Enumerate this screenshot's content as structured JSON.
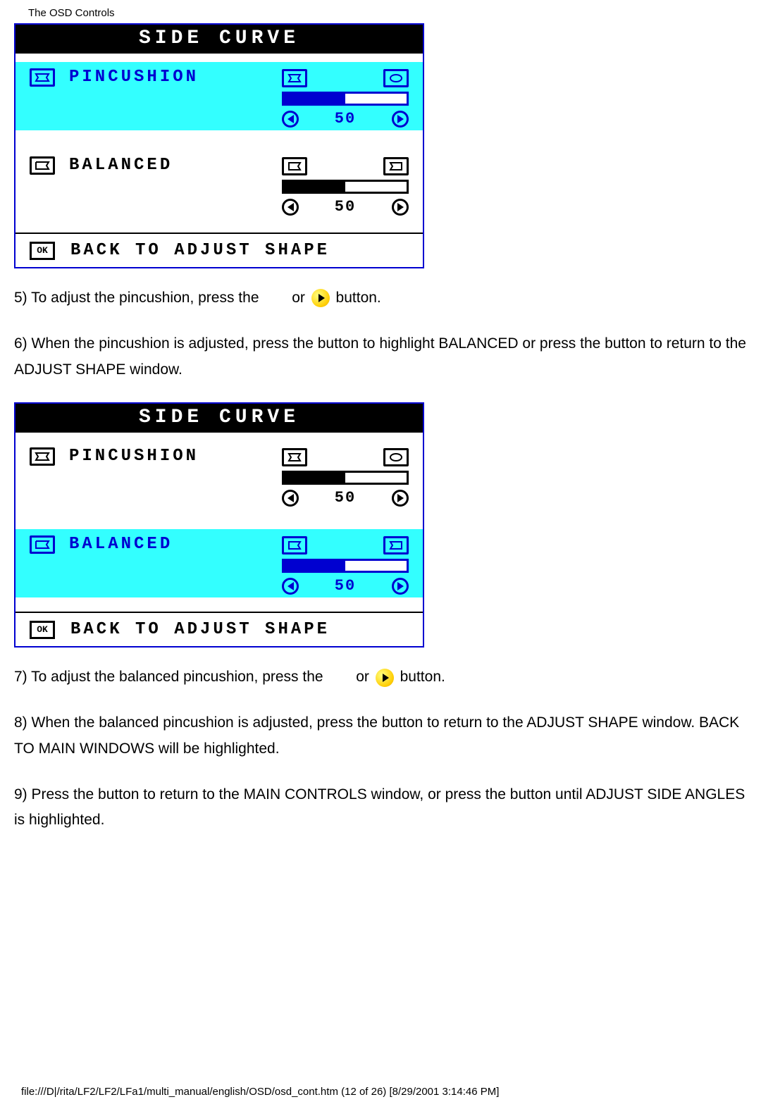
{
  "header": {
    "title": "The OSD Controls"
  },
  "osd1": {
    "title": "SIDE CURVE",
    "rows": [
      {
        "label": "PINCUSHION",
        "value": "50",
        "highlighted": true
      },
      {
        "label": "BALANCED",
        "value": "50",
        "highlighted": false
      }
    ],
    "footer": "BACK TO ADJUST SHAPE"
  },
  "osd2": {
    "title": "SIDE CURVE",
    "rows": [
      {
        "label": "PINCUSHION",
        "value": "50",
        "highlighted": false
      },
      {
        "label": "BALANCED",
        "value": "50",
        "highlighted": true
      }
    ],
    "footer": "BACK TO ADJUST SHAPE"
  },
  "instr": {
    "step5_a": "5) To adjust the pincushion, press the ",
    "step5_b": " or ",
    "step5_c": " button.",
    "step6": "6) When the pincushion is adjusted, press the        button to highlight BALANCED or press the        button to return to the ADJUST SHAPE window.",
    "step7_a": "7) To adjust the balanced pincushion, press the ",
    "step7_b": " or ",
    "step7_c": " button.",
    "step8": "8) When the balanced pincushion is adjusted, press the        button to return to the ADJUST SHAPE window. BACK TO MAIN WINDOWS will be highlighted.",
    "step9": "9) Press the        button to return to the MAIN CONTROLS window, or press the        button until ADJUST SIDE ANGLES is highlighted."
  },
  "footer_path": "file:///D|/rita/LF2/LF2/LFa1/multi_manual/english/OSD/osd_cont.htm (12 of 26) [8/29/2001 3:14:46 PM]"
}
